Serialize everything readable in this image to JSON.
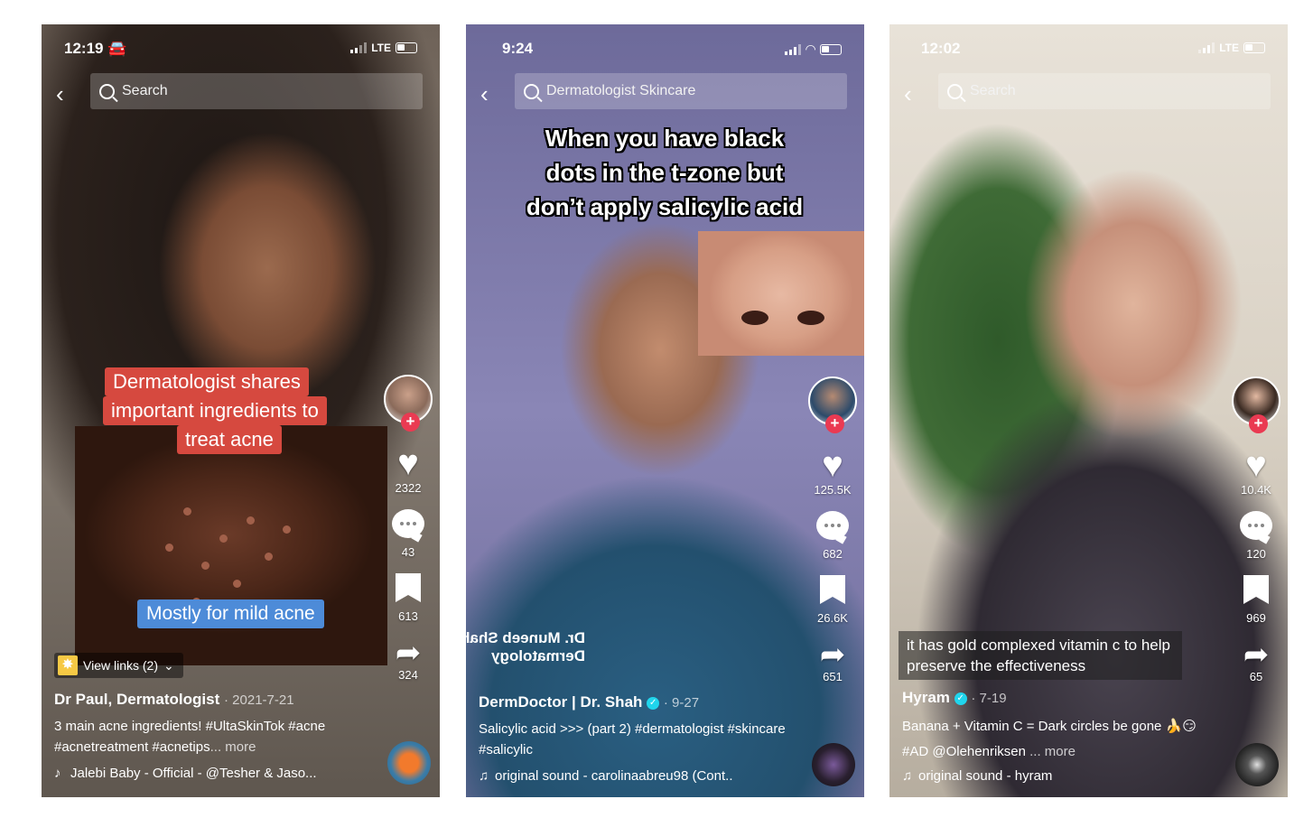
{
  "phones": [
    {
      "status": {
        "time": "12:19",
        "extra": "🚘",
        "network": "LTE"
      },
      "search": {
        "query": "Search"
      },
      "overlay": {
        "caption_lines": [
          "Dermatologist shares",
          "important ingredients to",
          "treat acne"
        ],
        "sub": "Mostly for mild acne"
      },
      "links": "View links (2)",
      "stats": {
        "likes": "2322",
        "comments": "43",
        "saves": "613",
        "shares": "324"
      },
      "author": "Dr Paul, Dermatologist",
      "date": "· 2021-7-21",
      "desc": "3 main acne ingredients! #UltaSkinTok #acne #acnetreatment #acnetips",
      "more": "... more",
      "sound": "Jalebi Baby - Official - @Tesher & Jaso..."
    },
    {
      "status": {
        "time": "9:24"
      },
      "search": {
        "query": "Dermatologist Skincare"
      },
      "overlay": {
        "caption_lines": [
          "When you have black",
          "dots in the t-zone but",
          "don’t apply salicylic acid"
        ],
        "mirrored_lines": [
          "Dr. Muneeb Shah",
          "Dermatology"
        ]
      },
      "stats": {
        "likes": "125.5K",
        "comments": "682",
        "saves": "26.6K",
        "shares": "651"
      },
      "author": "DermDoctor | Dr. Shah",
      "date": "· 9-27",
      "desc": "Salicylic acid >>> (part 2) #dermatologist #skincare #salicylic",
      "sound": "original sound - carolinaabreu98 (Cont.."
    },
    {
      "status": {
        "time": "12:02",
        "network": "LTE"
      },
      "search": {
        "query": "Search"
      },
      "overlay": {
        "sub": "it has gold complexed vitamin c to help preserve the effectiveness"
      },
      "stats": {
        "likes": "10.4K",
        "comments": "120",
        "saves": "969",
        "shares": "65"
      },
      "author": "Hyram",
      "date": "· 7-19",
      "desc": "Banana + Vitamin C = Dark circles be gone 🍌😏 #AD @Olehenriksen",
      "more": "... more",
      "sound": "original sound - hyram"
    }
  ],
  "colors": {
    "tiktok_red": "#ea3a52",
    "caption_red": "#d6493f",
    "caption_blue": "#4d8bd8",
    "verified": "#20d5ec"
  }
}
